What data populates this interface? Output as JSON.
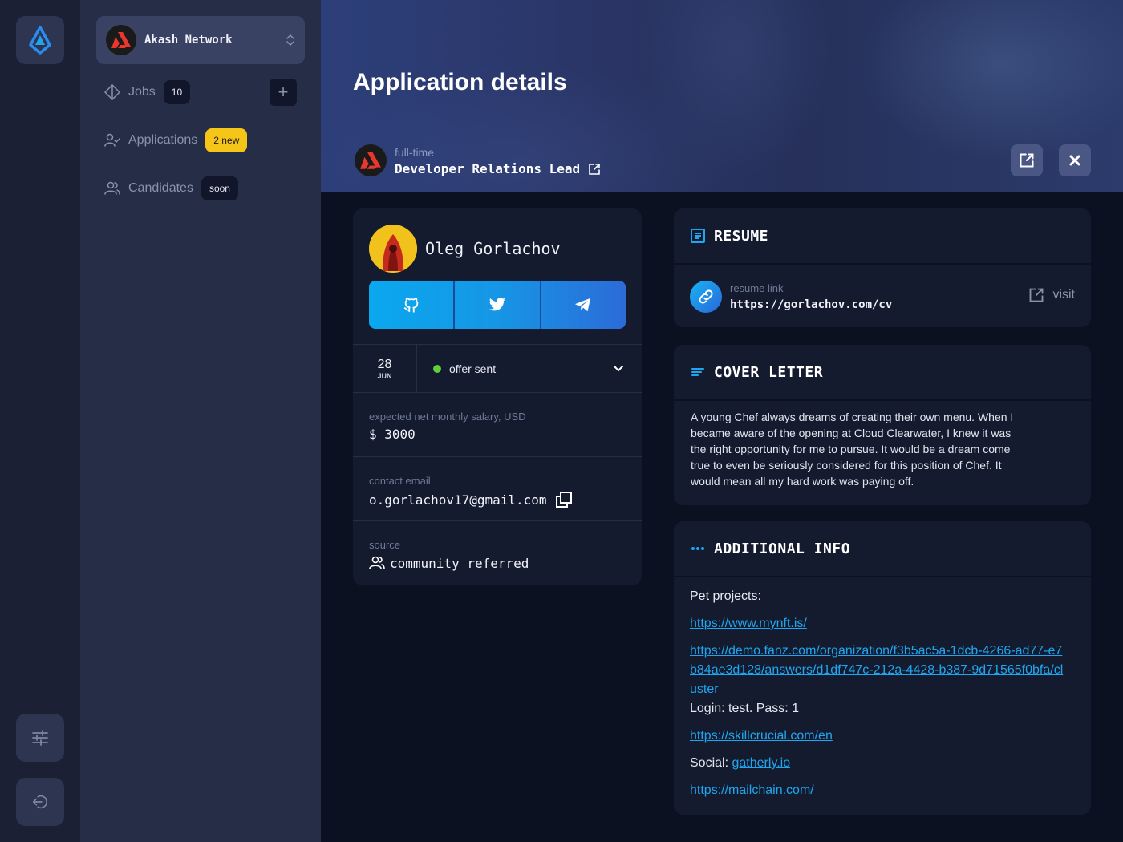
{
  "sidebar": {
    "org_name": "Akash Network",
    "nav": [
      {
        "label": "Jobs",
        "badge": "10"
      },
      {
        "label": "Applications",
        "badge": "2 new"
      },
      {
        "label": "Candidates",
        "badge": "soon"
      }
    ],
    "add_label": "+"
  },
  "header": {
    "title": "Application details",
    "job_type": "full-time",
    "job_title": "Developer Relations Lead"
  },
  "candidate": {
    "name": "Oleg Gorlachov",
    "date_day": "28",
    "date_month": "JUN",
    "status": "offer sent",
    "salary_label": "expected net monthly salary, USD",
    "salary_value": "$ 3000",
    "email_label": "contact email",
    "email_value": "o.gorlachov17@gmail.com",
    "source_label": "source",
    "source_value": "community referred"
  },
  "resume": {
    "title": "RESUME",
    "link_label": "resume link",
    "link_value": "https://gorlachov.com/cv",
    "visit_label": "visit"
  },
  "cover_letter": {
    "title": "COVER LETTER",
    "text": "A young Chef always dreams of creating their own menu. When I became aware of the opening at Cloud Clearwater, I knew it was the right opportunity for me to pursue. It would be a dream come true to even be seriously considered for this position of Chef. It would mean all my hard work was paying off."
  },
  "additional_info": {
    "title": "ADDITIONAL INFO",
    "pet_projects_label": "Pet projects:",
    "link1": "https://www.mynft.is/",
    "link2": "https://demo.fanz.com/organization/f3b5ac5a-1dcb-4266-ad77-e7b84ae3d128/answers/d1df747c-212a-4428-b387-9d71565f0bfa/cluster",
    "login_text": "Login: test. Pass: 1",
    "link3": "https://skillcrucial.com/en",
    "social_label": "Social:",
    "social_link": "gatherly.io",
    "link4": "https://mailchain.com/"
  },
  "colors": {
    "accent": "#1ea7f0",
    "status_green": "#5fcf3a",
    "badge_yellow": "#f5c518"
  }
}
